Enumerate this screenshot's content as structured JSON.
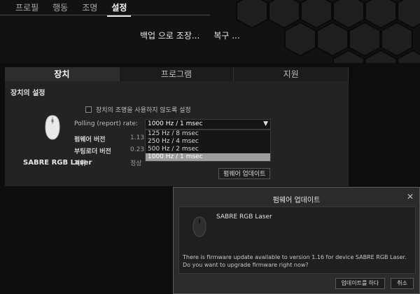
{
  "nav": {
    "items": [
      {
        "label": "프로필",
        "active": false
      },
      {
        "label": "행동",
        "active": false
      },
      {
        "label": "조명",
        "active": false
      },
      {
        "label": "설정",
        "active": true
      }
    ]
  },
  "sub_actions": {
    "backup": "백업 으로 조장...",
    "restore": "복구 ..."
  },
  "tabs": [
    {
      "label": "장치",
      "active": true
    },
    {
      "label": "프로그램",
      "active": false
    },
    {
      "label": "지원",
      "active": false
    }
  ],
  "device_settings": {
    "title": "장치의 설정",
    "device_name": "SABRE RGB Laser",
    "lighting_checkbox_label": "장치의 조명을 사용하지 않도록 설정",
    "polling_label": "Polling (report) rate:",
    "polling_selected": "1000 Hz / 1 msec",
    "polling_options": [
      {
        "label": "125 Hz / 8 msec",
        "selected": false
      },
      {
        "label": "250 Hz / 4 msec",
        "selected": false
      },
      {
        "label": "500 Hz / 2 msec",
        "selected": false
      },
      {
        "label": "1000 Hz / 1 msec",
        "selected": true
      }
    ],
    "firmware_version_label": "펌웨어 버전",
    "firmware_version_value": "1.13",
    "bootloader_version_label": "부팅로더 버전",
    "bootloader_version_value": "0.23",
    "status_label": "지위",
    "status_value": "정상",
    "firmware_update_button": "펌웨어 업데이트"
  },
  "dialog": {
    "title": "펌웨어 업데이트",
    "device_name": "SABRE RGB Laser",
    "message": "There is firmware update available to version 1.16 for device SABRE RGB Laser. Do you want to upgrade firmware right now?",
    "update_button": "업데이트를 하다",
    "cancel_button": "취소"
  },
  "icons": {
    "mouse": "mouse-icon",
    "close": "close-icon",
    "dropdown_arrow": "triangle-down-icon"
  },
  "colors": {
    "background": "#0d0d0d",
    "panel": "#232323",
    "selection": "#9e9e9e"
  }
}
